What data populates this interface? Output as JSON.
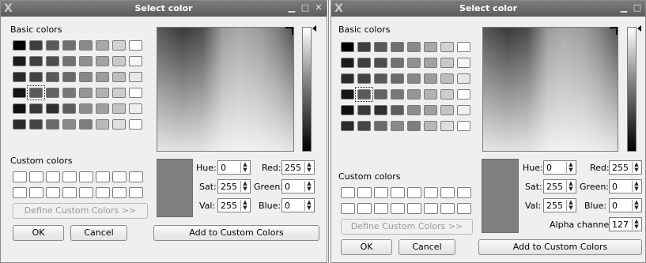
{
  "dialog": {
    "title": "Select color",
    "x_logo_glyph": "X",
    "minimize_glyph": "▁",
    "maximize_glyph": "□",
    "close_glyph": "✕",
    "basic_colors_label": "Basic colors",
    "custom_colors_label": "Custom colors",
    "define_custom_label": "Define Custom Colors >>",
    "ok_label": "OK",
    "cancel_label": "Cancel",
    "add_custom_label": "Add to Custom Colors",
    "hue_label": "Hue:",
    "sat_label": "Sat:",
    "val_label": "Val:",
    "red_label": "Red:",
    "green_label": "Green:",
    "blue_label": "Blue:",
    "alpha_label": "Alpha channel:",
    "hue_value": "0",
    "sat_value": "255",
    "val_value": "255",
    "red_value": "255",
    "green_value": "0",
    "blue_value": "0",
    "alpha_value": "127",
    "spin_arrows": "▲▼"
  },
  "basic_colors": [
    [
      "#000000",
      "#3f3f3f",
      "#5a5a5a",
      "#6e6e6e",
      "#8a8a8a",
      "#a8a8a8",
      "#d2d2d2",
      "#ffffff"
    ],
    [
      "#1c1c1c",
      "#404040",
      "#4e4e4e",
      "#727272",
      "#8f8f8f",
      "#a3a3a3",
      "#c9c9c9",
      "#f5f5f5"
    ],
    [
      "#2b2b2b",
      "#434343",
      "#595959",
      "#6a6a6a",
      "#878787",
      "#9c9c9c",
      "#bcbcbc",
      "#e7e7e7"
    ],
    [
      "#151515",
      "#5a5a5a",
      "#626262",
      "#787878",
      "#959595",
      "#b2b2b2",
      "#cdcdcd",
      "#ffffff"
    ],
    [
      "#101010",
      "#3a3a3a",
      "#2f2f2f",
      "#5c5c5c",
      "#8c8c8c",
      "#9e9e9e",
      "#c3c3c3",
      "#efefef"
    ],
    [
      "#2a2a2a",
      "#454545",
      "#6a6a6a",
      "#8a8a8a",
      "#7e7e7e",
      "#b9b9b9",
      "#dedede",
      "#ffffff"
    ]
  ]
}
